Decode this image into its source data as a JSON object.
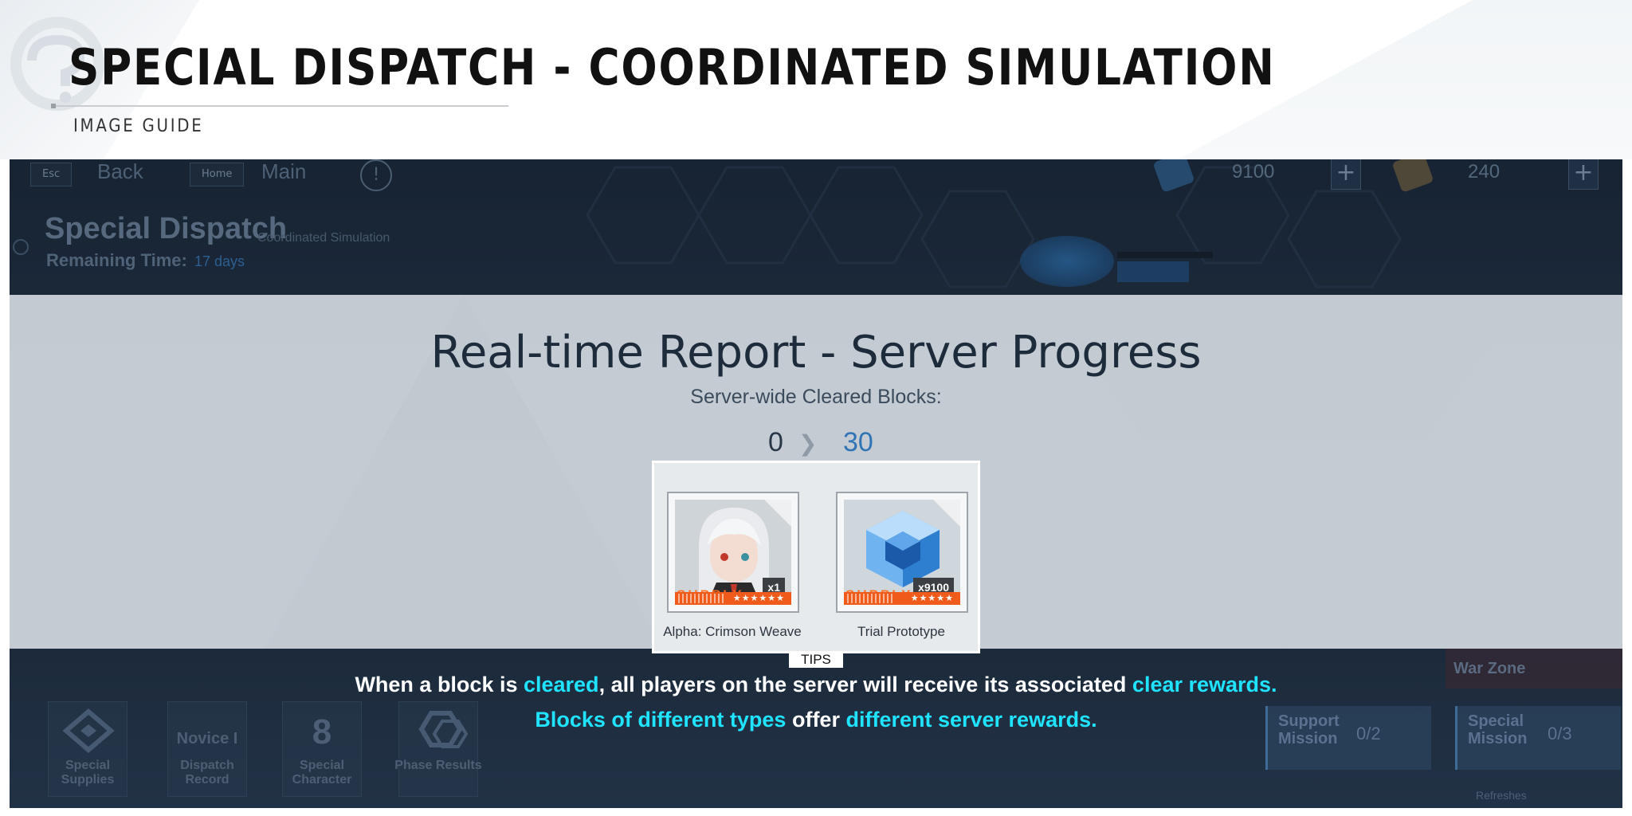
{
  "guide": {
    "title": "SPECIAL DISPATCH - COORDINATED SIMULATION",
    "subtitle": "IMAGE GUIDE"
  },
  "topbar": {
    "back_key": "Esc",
    "back_label": "Back",
    "home_key": "Home",
    "home_label": "Main",
    "info_glyph": "!",
    "resource_1_value": "9100",
    "resource_2_value": "240",
    "plus_glyph": "+"
  },
  "header": {
    "title": "Special Dispatch",
    "subtitle": "Coordinated Simulation",
    "remaining_label": "Remaining Time:",
    "remaining_value": "17 days"
  },
  "report": {
    "title": "Real-time Report - Server Progress",
    "subtitle": "Server-wide Cleared Blocks:",
    "cleared": "0",
    "total": "30"
  },
  "rewards": [
    {
      "name": "Alpha: Crimson Weave",
      "qty": "x1",
      "supply": "SUPPLY",
      "stars": "★★★★★★"
    },
    {
      "name": "Trial Prototype",
      "qty": "x9100",
      "supply": "SUPPLY",
      "stars": "★★★★★"
    }
  ],
  "tips_label": "TIPS",
  "caption": {
    "line1": {
      "p1": "When a block is ",
      "h1": "cleared",
      "p2": ", all players on the server will receive its associated ",
      "h2": "clear rewards."
    },
    "line2": {
      "h1": "Blocks of different types",
      "p1": " offer ",
      "h2": "different server rewards."
    }
  },
  "bottom_nav": [
    {
      "label": "Special Supplies"
    },
    {
      "label": "Dispatch Record",
      "badge": "Novice I"
    },
    {
      "label": "Special Character",
      "badge": "8"
    },
    {
      "label": "Phase Results"
    }
  ],
  "missions": {
    "support_label": "Support Mission",
    "support_count": "0/2",
    "special_label": "Special Mission",
    "special_count": "0/3",
    "warzone_label": "War Zone",
    "refresh_label": "Refreshes"
  },
  "colors": {
    "highlight": "#1fe3ff",
    "supply_orange": "#f05a1a",
    "accent_blue": "#2f74b5"
  },
  "icons": [
    "logo-icon",
    "info-icon",
    "currency-icon",
    "stamina-icon",
    "plus-icon",
    "supplies-icon",
    "phase-results-icon"
  ]
}
